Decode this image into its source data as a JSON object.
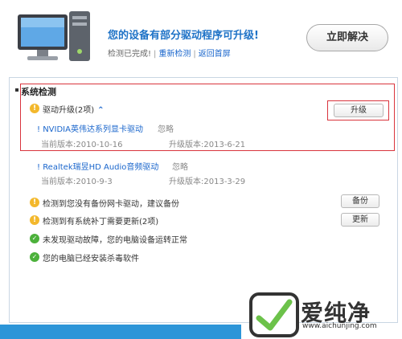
{
  "header": {
    "headline": "您的设备有部分驱动程序可升级!",
    "status": "检测已完成!",
    "recheck_link": "重新检测",
    "home_link": "返回首屏",
    "fix_button": "立即解决"
  },
  "section": {
    "title": "系统检测"
  },
  "driver_upgrade": {
    "label": "驱动升级(2项)",
    "upgrade_button": "升级",
    "drivers": [
      {
        "name": "NVIDIA英伟达系列显卡驱动",
        "ignore": "忽略",
        "current": "当前版本:2010-10-16",
        "upgrade": "升级版本:2013-6-21"
      },
      {
        "name": "Realtek瑞昱HD Audio音频驱动",
        "ignore": "忽略",
        "current": "当前版本:2010-9-3",
        "upgrade": "升级版本:2013-3-29"
      }
    ]
  },
  "checks": [
    {
      "text": "检测到您没有备份网卡驱动，建议备份",
      "button": "备份",
      "status": "warning"
    },
    {
      "text": "检测到有系统补丁需要更新(2项)",
      "button": "更新",
      "status": "warning"
    },
    {
      "text": "未发现驱动故障，您的电脑设备运转正常",
      "status": "ok"
    },
    {
      "text": "您的电脑已经安装杀毒软件",
      "status": "ok"
    }
  ],
  "watermark": {
    "brand": "爱纯净",
    "url": "www.aichunjing.com"
  },
  "colors": {
    "accent": "#1f73c7",
    "link": "#1a66cc",
    "highlight_box": "#d9343d",
    "warning": "#f3b82c",
    "ok": "#4cb13b",
    "bar": "#2c95d8"
  }
}
